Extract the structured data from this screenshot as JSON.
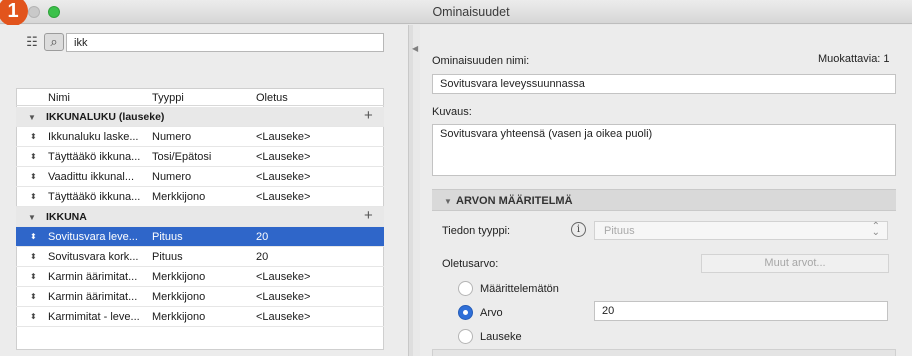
{
  "window": {
    "title": "Ominaisuudet",
    "step_badge": "1"
  },
  "toolbar": {
    "tree_icon": "list-tree-icon",
    "search_icon": "magnifier-icon",
    "search_value": "ikk"
  },
  "table": {
    "columns": [
      "Nimi",
      "Tyyppi",
      "Oletus"
    ],
    "groups": [
      {
        "name": "IKKUNALUKU (lauseke)",
        "rows": [
          {
            "name": "Ikkunaluku laske...",
            "type": "Numero",
            "default": "<Lauseke>"
          },
          {
            "name": "Täyttääkö ikkuna...",
            "type": "Tosi/Epätosi",
            "default": "<Lauseke>"
          },
          {
            "name": "Vaadittu ikkunal...",
            "type": "Numero",
            "default": "<Lauseke>"
          },
          {
            "name": "Täyttääkö ikkuna...",
            "type": "Merkkijono",
            "default": "<Lauseke>"
          }
        ]
      },
      {
        "name": "IKKUNA",
        "rows": [
          {
            "name": "Sovitusvara leve...",
            "type": "Pituus",
            "default": "20"
          },
          {
            "name": "Sovitusvara kork...",
            "type": "Pituus",
            "default": "20"
          },
          {
            "name": "Karmin äärimitat...",
            "type": "Merkkijono",
            "default": "<Lauseke>"
          },
          {
            "name": "Karmin äärimitat...",
            "type": "Merkkijono",
            "default": "<Lauseke>"
          },
          {
            "name": "Karmimitat - leve...",
            "type": "Merkkijono",
            "default": "<Lauseke>"
          }
        ]
      }
    ],
    "selected": "Sovitusvara leve..."
  },
  "detail": {
    "name_label": "Ominaisuuden nimi:",
    "editable_label": "Muokattavia: 1",
    "name_value": "Sovitusvara leveyssuunnassa",
    "description_label": "Kuvaus:",
    "description_value": "Sovitusvara yhteensä (vasen ja oikea puoli)",
    "section_title": "ARVON MÄÄRITELMÄ",
    "data_type_label": "Tiedon tyyppi:",
    "data_type_value": "Pituus",
    "default_label": "Oletusarvo:",
    "other_values_button": "Muut arvot...",
    "options": [
      "Määrittelemätön",
      "Arvo",
      "Lauseke"
    ],
    "selected_option": "Arvo",
    "value": "20"
  },
  "colors": {
    "selection": "#2f66c9",
    "badge": "#e2541c",
    "radio_on": "#2f6fd8"
  }
}
